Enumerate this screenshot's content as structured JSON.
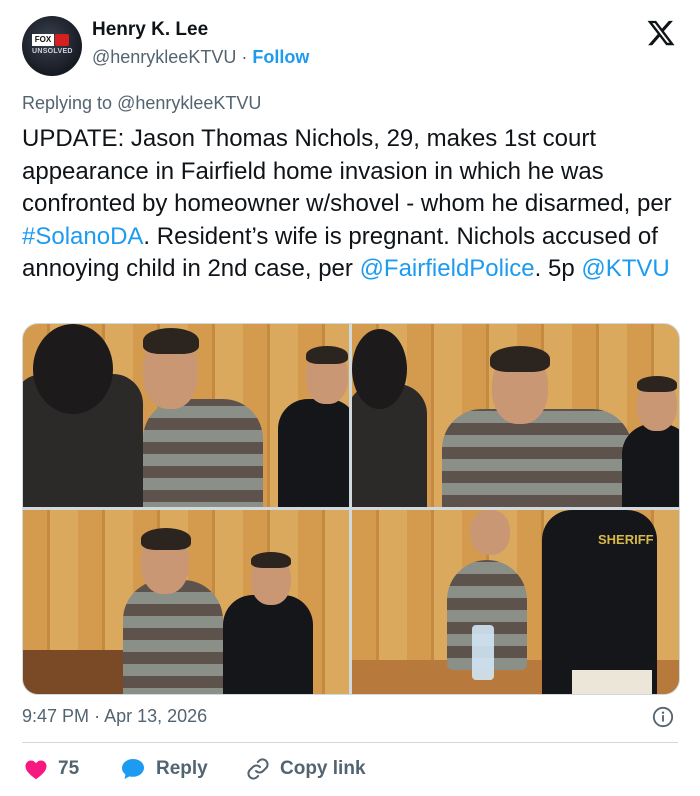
{
  "author": {
    "name": "Henry K. Lee",
    "handle": "@henrykleeKTVU",
    "separator": "·",
    "follow_label": "Follow",
    "avatar_text": "FOX",
    "avatar_subtext": "UNSOLVED"
  },
  "replying": {
    "prefix": "Replying to",
    "handle": "@henrykleeKTVU"
  },
  "tweet": {
    "t1": "UPDATE: Jason Thomas Nichols, 29, makes 1st court appearance in Fairfield home invasion in which he was confronted by homeowner w/shovel - whom he disarmed, per ",
    "l1": "#SolanoDA",
    "t2": ". Resident’s wife is pregnant. Nichols accused of  annoying child in 2nd case, per ",
    "l2": "@FairfieldPolice",
    "t3": ". 5p ",
    "l3": "@KTVU"
  },
  "media": {
    "sheriff_label": "SHERIFF"
  },
  "meta": {
    "time": "9:47 PM",
    "sep": "·",
    "date": "Apr 13, 2026"
  },
  "actions": {
    "likes": "75",
    "reply_label": "Reply",
    "copy_label": "Copy link"
  },
  "colors": {
    "accent": "#1d9bf0",
    "like": "#f91880",
    "muted": "#536471",
    "text": "#0f1419"
  }
}
